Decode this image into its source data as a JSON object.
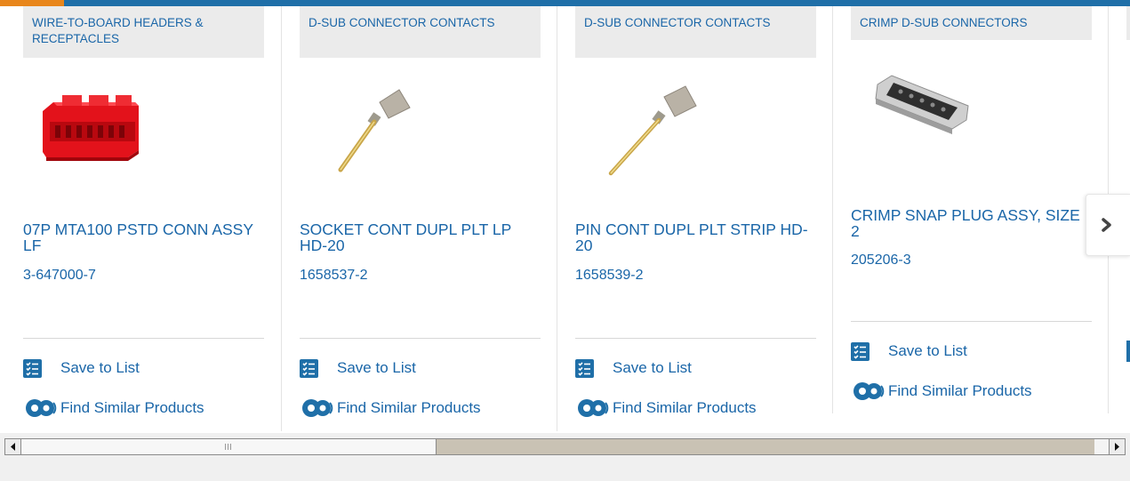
{
  "cards": [
    {
      "category": "WIRE-TO-BOARD HEADERS & RECEPTACLES",
      "title": "07P MTA100 PSTD CONN ASSY LF",
      "part_number": "3-647000-7",
      "image": "red-connector-housing",
      "save_label": "Save to List",
      "similar_label": "Find Similar Products"
    },
    {
      "category": "D-SUB CONNECTOR CONTACTS",
      "title": "SOCKET CONT DUPL PLT LP HD-20",
      "part_number": "1658537-2",
      "image": "socket-contact",
      "save_label": "Save to List",
      "similar_label": "Find Similar Products"
    },
    {
      "category": "D-SUB CONNECTOR CONTACTS",
      "title": "PIN CONT DUPL PLT STRIP HD-20",
      "part_number": "1658539-2",
      "image": "pin-contact",
      "save_label": "Save to List",
      "similar_label": "Find Similar Products"
    },
    {
      "category": "CRIMP D-SUB CONNECTORS",
      "title": "CRIMP SNAP PLUG ASSY, SIZE 2",
      "part_number": "205206-3",
      "image": "d-sub-plug",
      "save_label": "Save to List",
      "similar_label": "Find Similar Products"
    }
  ],
  "icons": {
    "save": "list-check-icon",
    "similar": "gears-icon",
    "next": "chevron-right-icon",
    "scroll_left": "arrow-left-icon",
    "scroll_right": "arrow-right-icon"
  },
  "colors": {
    "link": "#1a66a8",
    "accent_bar": "#1f6fa8",
    "accent_orange": "#e8861b",
    "category_bg": "#ebebeb"
  }
}
